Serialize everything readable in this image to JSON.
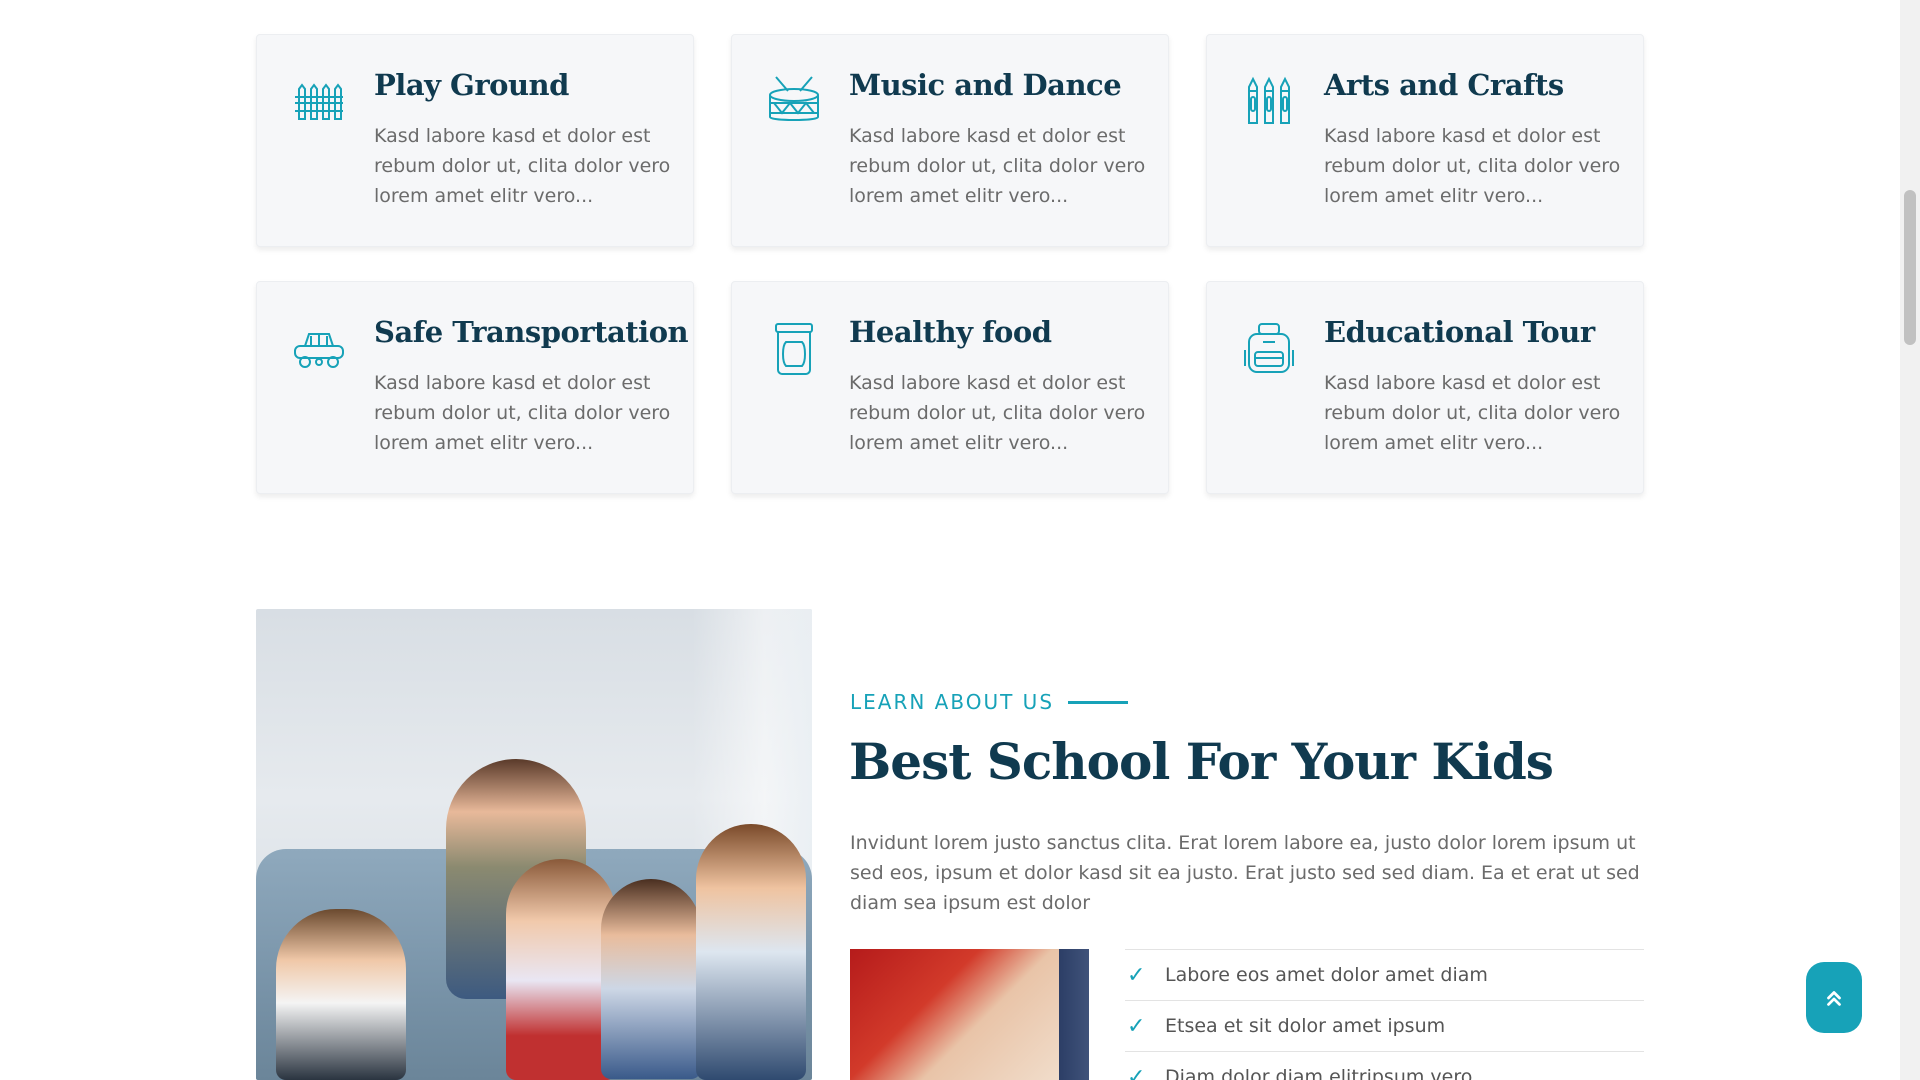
{
  "services": [
    {
      "title": "Play Ground",
      "text": "Kasd labore kasd et dolor est rebum dolor ut, clita dolor vero lorem amet elitr vero...",
      "icon": "fence-icon"
    },
    {
      "title": "Music and Dance",
      "text": "Kasd labore kasd et dolor est rebum dolor ut, clita dolor vero lorem amet elitr vero...",
      "icon": "drum-icon"
    },
    {
      "title": "Arts and Crafts",
      "text": "Kasd labore kasd et dolor est rebum dolor ut, clita dolor vero lorem amet elitr vero...",
      "icon": "crayons-icon"
    },
    {
      "title": "Safe Transportation",
      "text": "Kasd labore kasd et dolor est rebum dolor ut, clita dolor vero lorem amet elitr vero...",
      "icon": "car-icon"
    },
    {
      "title": "Healthy food",
      "text": "Kasd labore kasd et dolor est rebum dolor ut, clita dolor vero lorem amet elitr vero...",
      "icon": "jar-icon"
    },
    {
      "title": "Educational Tour",
      "text": "Kasd labore kasd et dolor est rebum dolor ut, clita dolor vero lorem amet elitr vero...",
      "icon": "backpack-icon"
    }
  ],
  "about": {
    "eyebrow": "LEARN ABOUT US",
    "title": "Best School For Your Kids",
    "text": "Invidunt lorem justo sanctus clita. Erat lorem labore ea, justo dolor lorem ipsum ut sed eos, ipsum et dolor kasd sit ea justo. Erat justo sed sed diam. Ea et erat ut sed diam sea ipsum est dolor",
    "checklist": [
      "Labore eos amet dolor amet diam",
      "Etsea et sit dolor amet ipsum",
      "Diam dolor diam elitripsum vero"
    ]
  },
  "colors": {
    "accent": "#17a2b8",
    "heading": "#103a4f",
    "card_bg": "#f6f7f9"
  },
  "back_to_top_icon": "double-chevron-up-icon"
}
